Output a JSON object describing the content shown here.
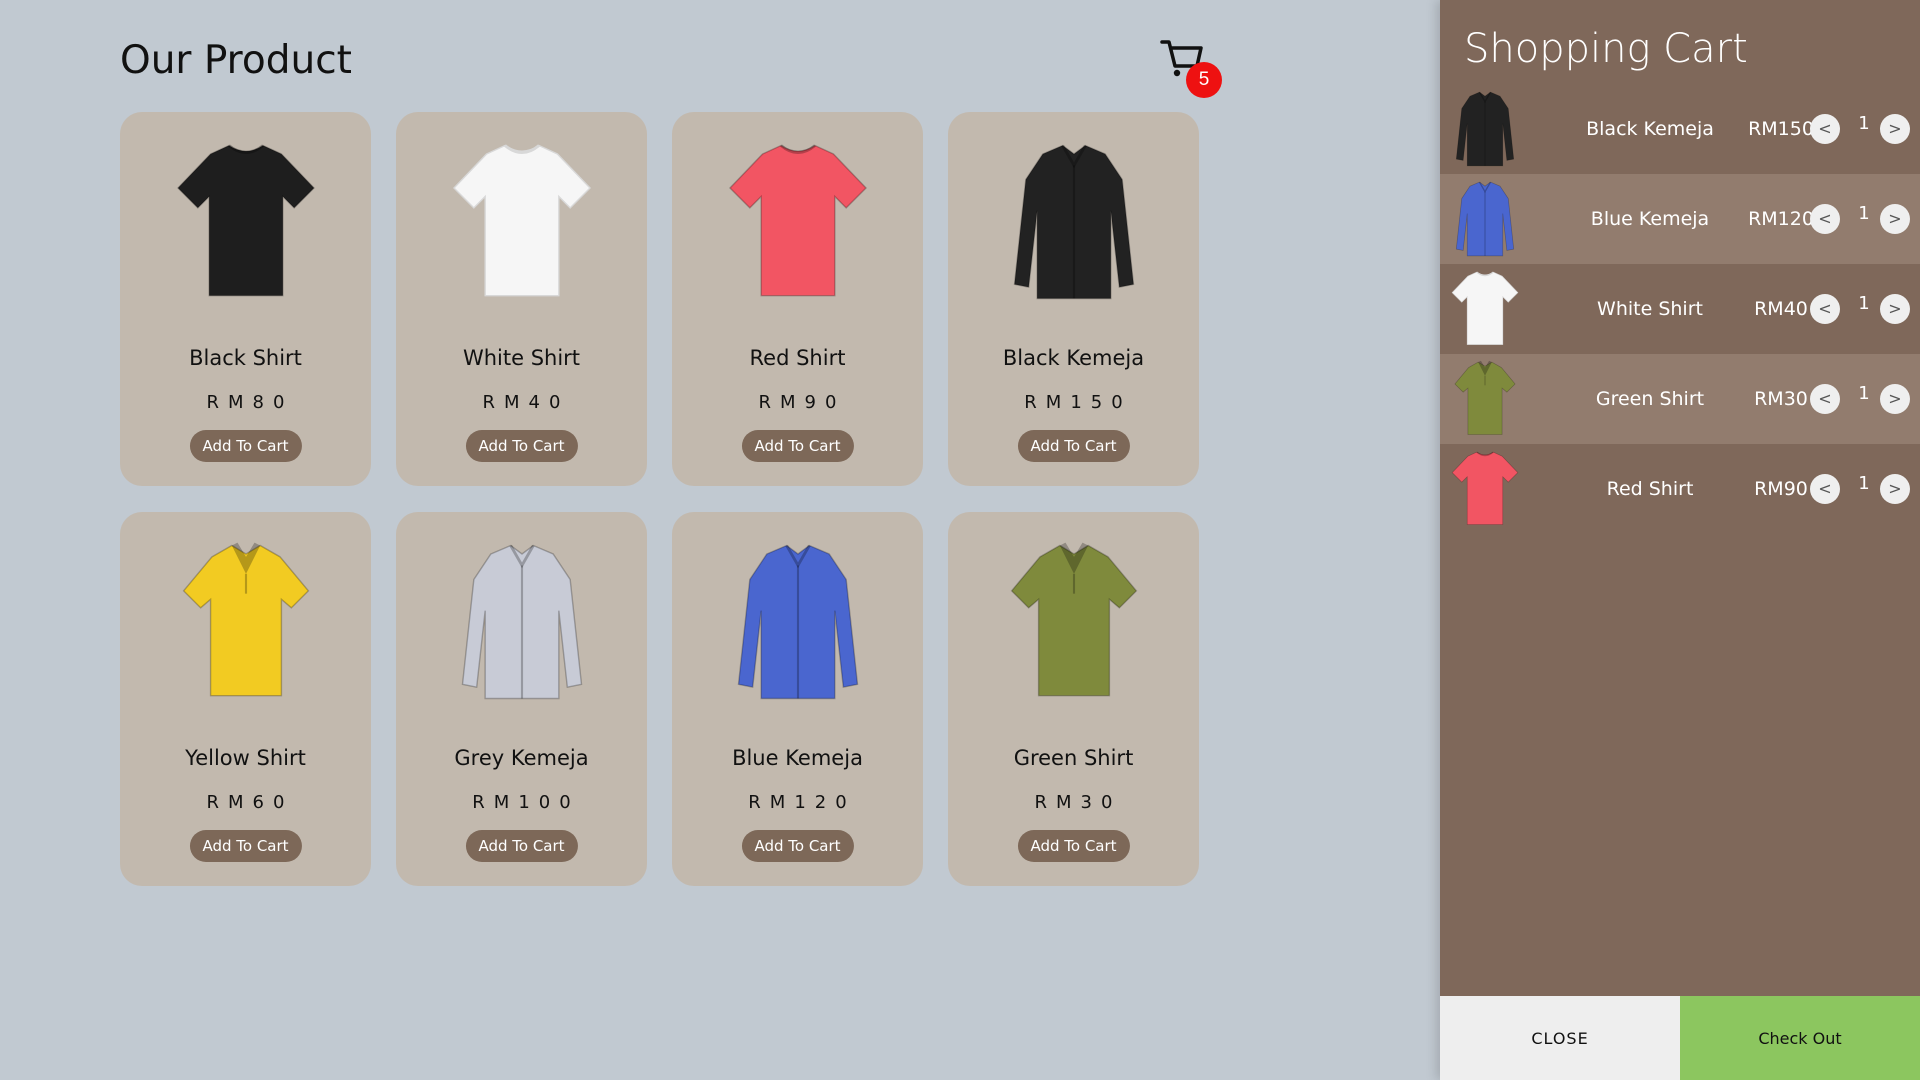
{
  "header": {
    "title": "Our Product",
    "cart_count": "5"
  },
  "products": [
    {
      "name": "Black Shirt",
      "price": "RM80",
      "button": "Add To Cart",
      "color": "#1e1e1e",
      "style": "tshirt"
    },
    {
      "name": "White Shirt",
      "price": "RM40",
      "button": "Add To Cart",
      "color": "#f6f6f6",
      "style": "tshirt"
    },
    {
      "name": "Red Shirt",
      "price": "RM90",
      "button": "Add To Cart",
      "color": "#f25563",
      "style": "tshirt"
    },
    {
      "name": "Black Kemeja",
      "price": "RM150",
      "button": "Add To Cart",
      "color": "#222222",
      "style": "longshirt"
    },
    {
      "name": "Yellow Shirt",
      "price": "RM60",
      "button": "Add To Cart",
      "color": "#f2cb22",
      "style": "polo"
    },
    {
      "name": "Grey Kemeja",
      "price": "RM100",
      "button": "Add To Cart",
      "color": "#c8cbd6",
      "style": "longshirt"
    },
    {
      "name": "Blue Kemeja",
      "price": "RM120",
      "button": "Add To Cart",
      "color": "#4a66cf",
      "style": "longshirt"
    },
    {
      "name": "Green Shirt",
      "price": "RM30",
      "button": "Add To Cart",
      "color": "#7f8a3c",
      "style": "polo"
    }
  ],
  "cart": {
    "title": "Shopping Cart",
    "items": [
      {
        "name": "Black Kemeja",
        "price": "RM150",
        "qty": "1",
        "minus": "<",
        "plus": ">",
        "color": "#222222",
        "style": "longshirt"
      },
      {
        "name": "Blue Kemeja",
        "price": "RM120",
        "qty": "1",
        "minus": "<",
        "plus": ">",
        "color": "#4a66cf",
        "style": "longshirt"
      },
      {
        "name": "White Shirt",
        "price": "RM40",
        "qty": "1",
        "minus": "<",
        "plus": ">",
        "color": "#f6f6f6",
        "style": "tshirt"
      },
      {
        "name": "Green Shirt",
        "price": "RM30",
        "qty": "1",
        "minus": "<",
        "plus": ">",
        "color": "#7f8a3c",
        "style": "polo"
      },
      {
        "name": "Red Shirt",
        "price": "RM90",
        "qty": "1",
        "minus": "<",
        "plus": ">",
        "color": "#f25563",
        "style": "tshirt"
      }
    ],
    "close_label": "CLOSE",
    "checkout_label": "Check Out"
  }
}
